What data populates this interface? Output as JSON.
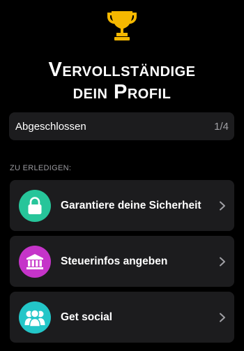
{
  "header": {
    "trophy_icon": "trophy-icon",
    "trophy_color": "#f5b800",
    "title_line1": "Vervollständige",
    "title_line2": "dein Profil"
  },
  "progress": {
    "label": "Abgeschlossen",
    "count": "1/4",
    "completed": 1,
    "total": 4
  },
  "todo": {
    "section_title": "ZU ERLEDIGEN:",
    "tasks": [
      {
        "label": "Garantiere deine Sicherheit",
        "icon": "lock-icon",
        "color": "#27c59a"
      },
      {
        "label": "Steuerinfos angeben",
        "icon": "bank-icon",
        "color": "#c534c9"
      },
      {
        "label": "Get social",
        "icon": "people-icon",
        "color": "#23c6c8"
      }
    ],
    "chevron_icon": "chevron-right-icon"
  }
}
